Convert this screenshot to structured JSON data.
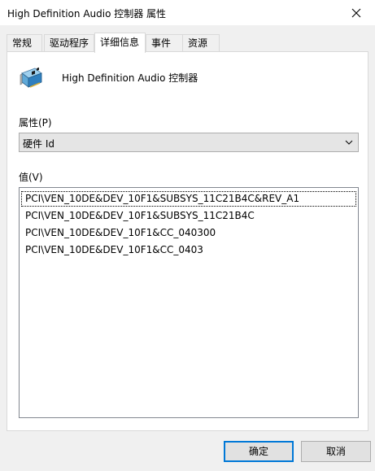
{
  "window": {
    "title": "High Definition Audio 控制器 属性"
  },
  "tabs": [
    {
      "label": "常规",
      "active": false
    },
    {
      "label": "驱动程序",
      "active": false
    },
    {
      "label": "详细信息",
      "active": true
    },
    {
      "label": "事件",
      "active": false
    },
    {
      "label": "资源",
      "active": false
    }
  ],
  "device": {
    "icon": "sound-card-icon",
    "name": "High Definition Audio 控制器"
  },
  "property": {
    "label": "属性(P)",
    "selected": "硬件 Id"
  },
  "values": {
    "label": "值(V)",
    "items": [
      "PCI\\VEN_10DE&DEV_10F1&SUBSYS_11C21B4C&REV_A1",
      "PCI\\VEN_10DE&DEV_10F1&SUBSYS_11C21B4C",
      "PCI\\VEN_10DE&DEV_10F1&CC_040300",
      "PCI\\VEN_10DE&DEV_10F1&CC_0403"
    ]
  },
  "buttons": {
    "ok": "确定",
    "cancel": "取消"
  },
  "colors": {
    "accent": "#0078d7",
    "dialog_bg": "#f0f0f0"
  }
}
